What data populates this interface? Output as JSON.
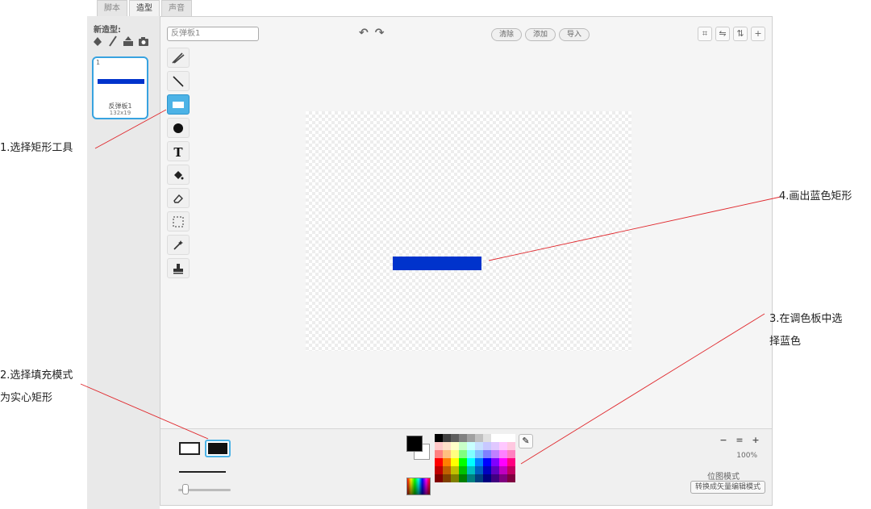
{
  "tabs": [
    {
      "label": "脚本"
    },
    {
      "label": "造型",
      "active": true
    },
    {
      "label": "声音"
    }
  ],
  "costumes_panel": {
    "new_label": "新造型:",
    "costume": {
      "number": "1",
      "name": "反弹板1",
      "size": "132x19"
    }
  },
  "editor": {
    "name_value": "反弹板1",
    "buttons": {
      "clear": "清除",
      "add": "添加",
      "import": "导入"
    },
    "zoom_percent": "100%",
    "mode_label": "位图模式",
    "convert_label": "转换成矢量编辑模式"
  },
  "annotations": {
    "step1": "1.选择矩形工具",
    "step2_line1": "2.选择填充模式",
    "step2_line2": "为实心矩形",
    "step3_line1": "3.在调色板中选",
    "step3_line2": "择蓝色",
    "step4": "4.画出蓝色矩形"
  },
  "colors": {
    "rect_blue": "#0033cc",
    "accent": "#4db3e6",
    "annotation_line": "#e0282d"
  },
  "palette": [
    "#000000",
    "#404040",
    "#5e5e5e",
    "#808080",
    "#a0a0a0",
    "#c0c0c0",
    "#e0e0e0",
    "#ffffff",
    "#ffffff",
    "#ffffff",
    "#ffc8c8",
    "#ffe0c8",
    "#ffffc8",
    "#c8ffc8",
    "#c8ffff",
    "#c8e0ff",
    "#c8c8ff",
    "#e0c8ff",
    "#ffc8ff",
    "#ffc8e0",
    "#ff8080",
    "#ffc080",
    "#ffff80",
    "#80ff80",
    "#80ffff",
    "#80c0ff",
    "#8080ff",
    "#c080ff",
    "#ff80ff",
    "#ff80c0",
    "#ff0000",
    "#ff8000",
    "#ffff00",
    "#00ff00",
    "#00ffff",
    "#0080ff",
    "#0000ff",
    "#8000ff",
    "#ff00ff",
    "#ff0080",
    "#c00000",
    "#c06000",
    "#c0c000",
    "#00c000",
    "#00c0c0",
    "#0060c0",
    "#0000c0",
    "#6000c0",
    "#c000c0",
    "#c00060",
    "#800000",
    "#804000",
    "#808000",
    "#008000",
    "#008080",
    "#004080",
    "#000080",
    "#400080",
    "#800080",
    "#800040"
  ]
}
